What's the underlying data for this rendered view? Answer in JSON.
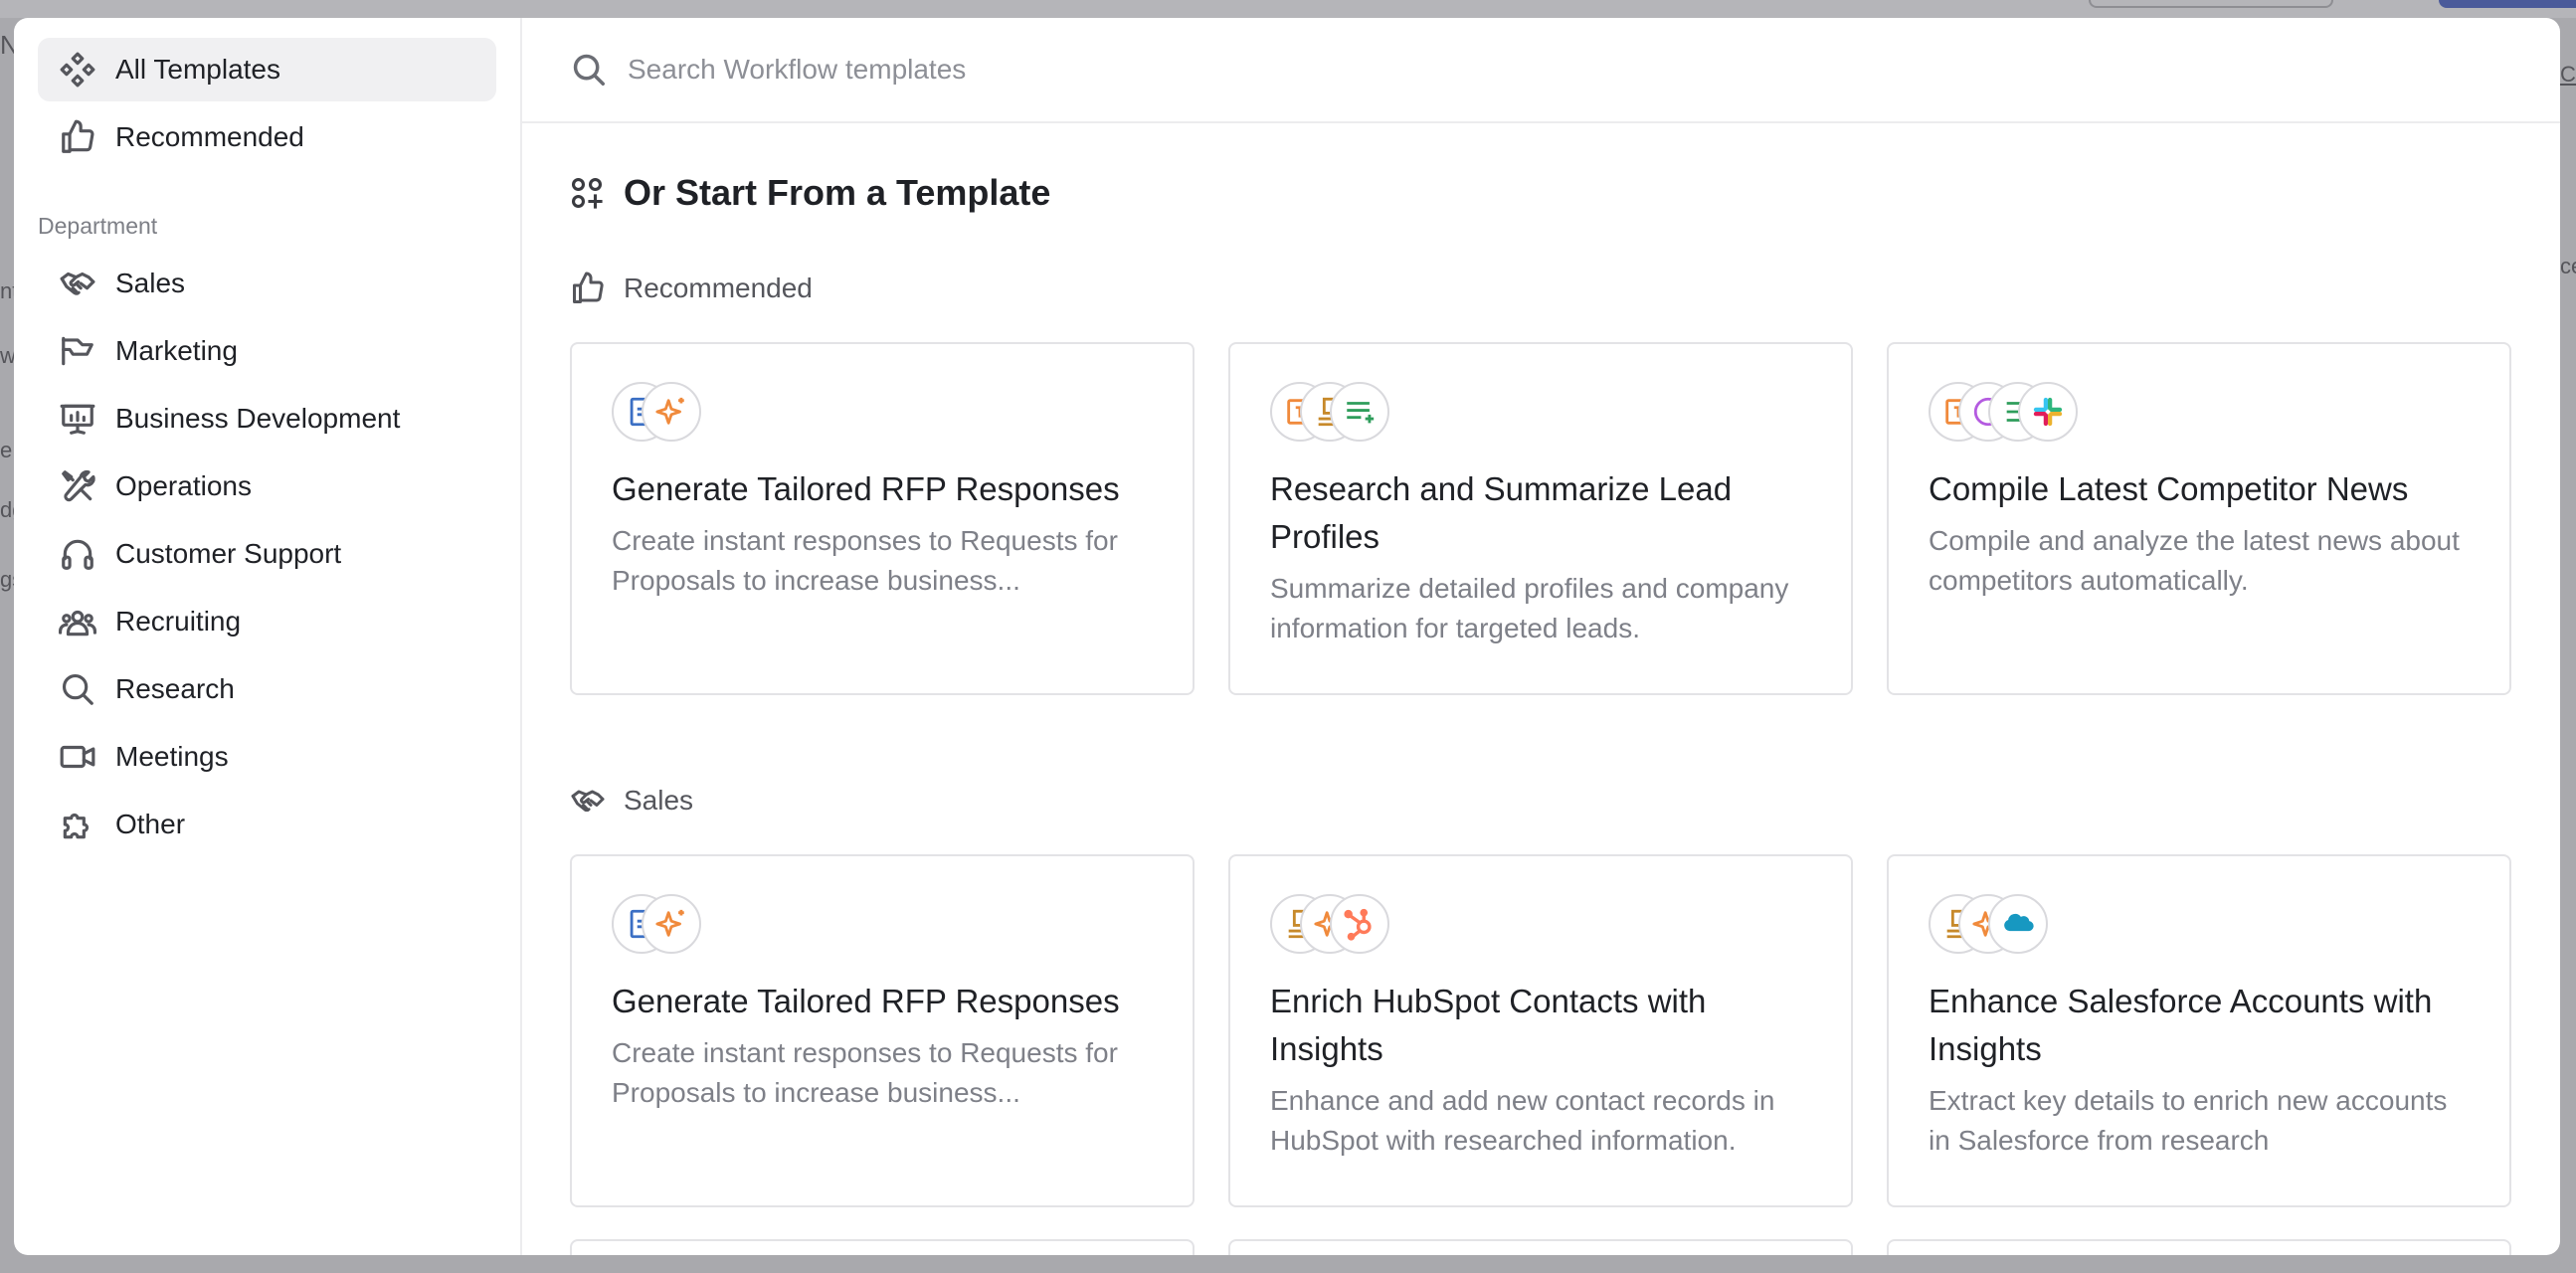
{
  "sidebar": {
    "top_items": [
      {
        "label": "All Templates",
        "icon": "templates-icon",
        "active": true
      },
      {
        "label": "Recommended",
        "icon": "thumbs-up-icon"
      }
    ],
    "section_label": "Department",
    "dept_items": [
      {
        "label": "Sales",
        "icon": "handshake-icon"
      },
      {
        "label": "Marketing",
        "icon": "megaphone-icon"
      },
      {
        "label": "Business Development",
        "icon": "presentation-icon"
      },
      {
        "label": "Operations",
        "icon": "tools-icon"
      },
      {
        "label": "Customer Support",
        "icon": "headphones-icon"
      },
      {
        "label": "Recruiting",
        "icon": "people-icon"
      },
      {
        "label": "Research",
        "icon": "search-icon"
      },
      {
        "label": "Meetings",
        "icon": "video-icon"
      },
      {
        "label": "Other",
        "icon": "puzzle-icon"
      }
    ]
  },
  "search": {
    "placeholder": "Search Workflow templates",
    "value": ""
  },
  "main": {
    "title": "Or Start From a Template",
    "sections": [
      {
        "heading": "Recommended",
        "icon": "thumbs-up-icon",
        "cards": [
          {
            "title": "Generate Tailored RFP Responses",
            "description": "Create instant responses to Requests for Proposals to increase business...",
            "app_icons": [
              "document-icon",
              "sparkle-icon"
            ]
          },
          {
            "title": "Research and Summarize Lead Profiles",
            "description": "Summarize detailed profiles and company information for targeted leads.",
            "app_icons": [
              "text-card-icon",
              "stamp-icon",
              "list-add-icon"
            ]
          },
          {
            "title": "Compile Latest Competitor News",
            "description": "Compile and analyze the latest news about competitors automatically.",
            "app_icons": [
              "text-card-icon",
              "globe-icon",
              "list-icon",
              "slack-icon"
            ]
          }
        ]
      },
      {
        "heading": "Sales",
        "icon": "handshake-icon",
        "cards": [
          {
            "title": "Generate Tailored RFP Responses",
            "description": "Create instant responses to Requests for Proposals to increase business...",
            "app_icons": [
              "document-icon",
              "sparkle-icon"
            ]
          },
          {
            "title": "Enrich HubSpot Contacts with Insights",
            "description": "Enhance and add new contact records in HubSpot with researched information.",
            "app_icons": [
              "stamp-icon",
              "sparkle-icon",
              "hubspot-icon"
            ]
          },
          {
            "title": "Enhance Salesforce Accounts with Insights",
            "description": "Extract key details to enrich new accounts in Salesforce from research",
            "app_icons": [
              "stamp-icon",
              "sparkle-icon",
              "salesforce-icon"
            ]
          }
        ]
      }
    ]
  },
  "colors": {
    "accent_orange": "#f08a3c",
    "salesforce_blue": "#1798c1",
    "hubspot_orange": "#ff7a59",
    "sheets_green": "#2e9d5b",
    "doc_blue": "#3b6fc4",
    "purple": "#b45be0"
  },
  "backdrop": {
    "fragments": [
      "N",
      "nt",
      "w",
      "e",
      "dg",
      "gs"
    ],
    "right_fragments": [
      "Cr",
      "ce"
    ]
  }
}
